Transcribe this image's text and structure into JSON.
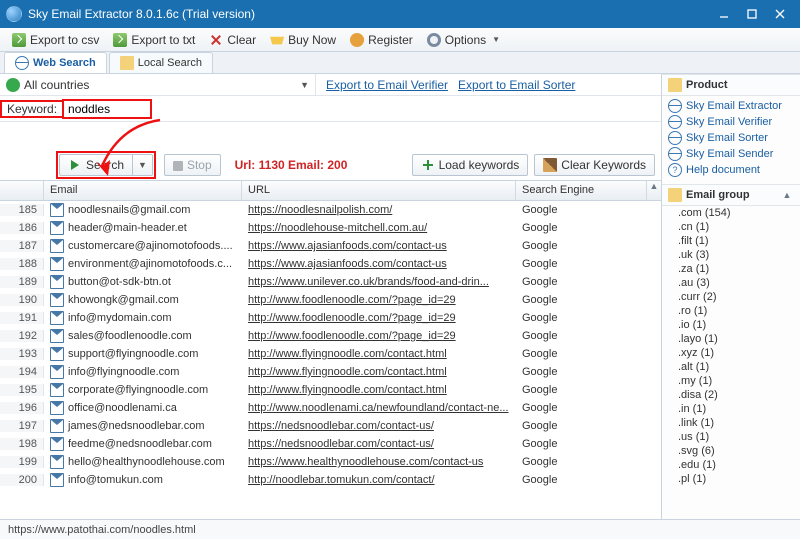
{
  "window": {
    "title": "Sky Email Extractor 8.0.1.6c (Trial version)"
  },
  "toolbar": {
    "export_csv": "Export to csv",
    "export_txt": "Export to txt",
    "clear": "Clear",
    "buy": "Buy Now",
    "register": "Register",
    "options": "Options"
  },
  "tabs": {
    "web": "Web Search",
    "local": "Local Search"
  },
  "country": "All countries",
  "links": {
    "verifier": "Export to Email Verifier",
    "sorter": "Export to Email Sorter"
  },
  "keyword_label": "Keyword:",
  "keyword_value": "noddles",
  "buttons": {
    "search": "Search",
    "stop": "Stop",
    "load": "Load keywords",
    "clearkw": "Clear Keywords"
  },
  "stats": "Url: 1130 Email: 200",
  "columns": {
    "email": "Email",
    "url": "URL",
    "se": "Search Engine"
  },
  "rows": [
    {
      "n": 185,
      "email": "noodlesnails@gmail.com",
      "url": "https://noodlesnailpolish.com/",
      "se": "Google"
    },
    {
      "n": 186,
      "email": "header@main-header.et",
      "url": "https://noodlehouse-mitchell.com.au/",
      "se": "Google"
    },
    {
      "n": 187,
      "email": "customercare@ajinomotofoods....",
      "url": "https://www.ajasianfoods.com/contact-us",
      "se": "Google"
    },
    {
      "n": 188,
      "email": "environment@ajinomotofoods.c...",
      "url": "https://www.ajasianfoods.com/contact-us",
      "se": "Google"
    },
    {
      "n": 189,
      "email": "button@ot-sdk-btn.ot",
      "url": "https://www.unilever.co.uk/brands/food-and-drin...",
      "se": "Google"
    },
    {
      "n": 190,
      "email": "khowongk@gmail.com",
      "url": "http://www.foodlenoodle.com/?page_id=29",
      "se": "Google"
    },
    {
      "n": 191,
      "email": "info@mydomain.com",
      "url": "http://www.foodlenoodle.com/?page_id=29",
      "se": "Google"
    },
    {
      "n": 192,
      "email": "sales@foodlenoodle.com",
      "url": "http://www.foodlenoodle.com/?page_id=29",
      "se": "Google"
    },
    {
      "n": 193,
      "email": "support@flyingnoodle.com",
      "url": "http://www.flyingnoodle.com/contact.html",
      "se": "Google"
    },
    {
      "n": 194,
      "email": "info@flyingnoodle.com",
      "url": "http://www.flyingnoodle.com/contact.html",
      "se": "Google"
    },
    {
      "n": 195,
      "email": "corporate@flyingnoodle.com",
      "url": "http://www.flyingnoodle.com/contact.html",
      "se": "Google"
    },
    {
      "n": 196,
      "email": "office@noodlenami.ca",
      "url": "http://www.noodlenami.ca/newfoundland/contact-ne...",
      "se": "Google"
    },
    {
      "n": 197,
      "email": "james@nedsnoodlebar.com",
      "url": "https://nedsnoodlebar.com/contact-us/",
      "se": "Google"
    },
    {
      "n": 198,
      "email": "feedme@nedsnoodlebar.com",
      "url": "https://nedsnoodlebar.com/contact-us/",
      "se": "Google"
    },
    {
      "n": 199,
      "email": "hello@healthynoodlehouse.com",
      "url": "https://www.healthynoodlehouse.com/contact-us",
      "se": "Google"
    },
    {
      "n": 200,
      "email": "info@tomukun.com",
      "url": "http://noodlebar.tomukun.com/contact/",
      "se": "Google"
    }
  ],
  "product_panel": {
    "title": "Product",
    "items": [
      "Sky Email Extractor",
      "Sky Email Verifier",
      "Sky Email Sorter",
      "Sky Email Sender",
      "Help document"
    ]
  },
  "group_panel": {
    "title": "Email group",
    "items": [
      ".com (154)",
      ".cn (1)",
      ".filt (1)",
      ".uk (3)",
      ".za (1)",
      ".au (3)",
      ".curr (2)",
      ".ro (1)",
      ".io (1)",
      ".layo (1)",
      ".xyz (1)",
      ".alt (1)",
      ".my (1)",
      ".disa (2)",
      ".in (1)",
      ".link (1)",
      ".us (1)",
      ".svg (6)",
      ".edu (1)",
      ".pl (1)"
    ]
  },
  "status": "https://www.patothai.com/noodles.html"
}
